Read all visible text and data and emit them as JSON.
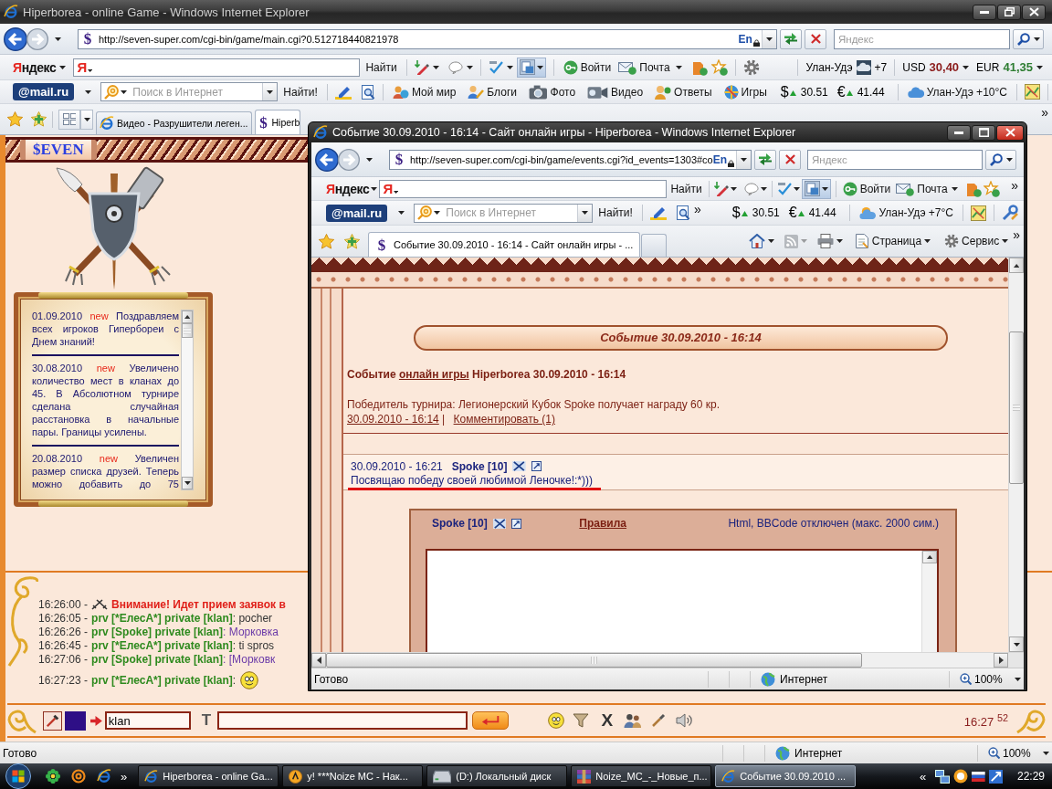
{
  "main_window": {
    "title": "Hiperborea - online Game - Windows Internet Explorer",
    "favicon": "$",
    "address": "http://seven-super.com/cgi-bin/game/main.cgi?0.512718440821978",
    "lang": "En",
    "search_placeholder": "Яндекс",
    "yandex_bar": {
      "logo": "Яндекс",
      "field_logo": "Я",
      "find": "Найти",
      "login": "Войти",
      "mail": "Почта",
      "city": "Улан-Удэ",
      "temperature": "+7",
      "currencies": [
        {
          "code": "USD",
          "value": "30,40",
          "color": "#8b1c1c"
        },
        {
          "code": "EUR",
          "value": "41,35",
          "color": "#2e7d32"
        }
      ]
    },
    "mail_bar": {
      "logo": "@mail.ru",
      "placeholder": "Поиск в Интернет",
      "find": "Найти!",
      "links": [
        {
          "kind": "world",
          "label": "Мой мир"
        },
        {
          "kind": "blogs",
          "label": "Блоги"
        },
        {
          "kind": "photo",
          "label": "Фото"
        },
        {
          "kind": "video",
          "label": "Видео"
        },
        {
          "kind": "answers",
          "label": "Ответы"
        },
        {
          "kind": "games",
          "label": "Игры"
        }
      ],
      "rates": [
        {
          "sign": "$",
          "value": "30.51"
        },
        {
          "sign": "€",
          "value": "41.44"
        }
      ],
      "weather": "Улан-Удэ +10°C"
    },
    "tabs": [
      {
        "kind": "ie",
        "label": "Видео - Разрушители леген...",
        "selected": false
      },
      {
        "kind": "site",
        "favicon": "$",
        "label": "Hiperb",
        "selected": true
      }
    ],
    "more": "»",
    "status": "Готово",
    "zone": "Интернет",
    "zoom": "100%"
  },
  "game": {
    "logo": "$EVEN",
    "news": [
      {
        "date": "01.09.2010",
        "badge": "new",
        "text": "Поздравляем всех игроков Гипербореи с Днем знаний!"
      },
      {
        "date": "30.08.2010",
        "badge": "new",
        "text": "Увеличено количество мест в кланах до 45. В Абсолютном турнире сделана случайная расстановка в начальные пары. Границы усилены."
      },
      {
        "date": "20.08.2010",
        "badge": "new",
        "text": "Увеличен размер списка друзей. Теперь можно добавить до 75"
      }
    ],
    "chat": [
      {
        "kind": "system",
        "time": "16:26:00 -",
        "text": "Внимание! Идет прием заявок в"
      },
      {
        "kind": "private",
        "time": "16:26:05 -",
        "sender": "prv [*ЕлесА*] private [klan]",
        "text": ": pocher",
        "color": "#333333"
      },
      {
        "kind": "private",
        "time": "16:26:26 -",
        "sender": "prv [Spoke] private [klan]",
        "text": ": Морковка",
        "color": "#6a3aa8"
      },
      {
        "kind": "private",
        "time": "16:26:45 -",
        "sender": "prv [*ЕлесА*] private [klan]",
        "text": ": ti spros",
        "color": "#333333"
      },
      {
        "kind": "private",
        "time": "16:27:06 -",
        "sender": "prv [Spoke] private [klan]",
        "text": ": [Морковк",
        "color": "#6a3aa8"
      },
      {
        "kind": "smiley",
        "time": "16:27:23 -",
        "sender": "prv [*ЕлесА*] private [klan]",
        "text": ":"
      }
    ],
    "input_bar": {
      "channel": "klan",
      "font_button": "T",
      "clear_button": "X",
      "clock": "16:27 $^{52}$"
    }
  },
  "event_window": {
    "title": "Событие 30.09.2010 - 16:14 - Сайт онлайн игры - Hiperborea - Windows Internet Explorer",
    "favicon": "$",
    "address": "http://seven-super.com/cgi-bin/game/events.cgi?id_events=1303#co",
    "lang": "En",
    "search_placeholder": "Яндекс",
    "yandex_bar": {
      "logo": "Яндекс",
      "field_logo": "Я",
      "find": "Найти",
      "login": "Войти",
      "mail": "Почта",
      "more": "»"
    },
    "mail_bar": {
      "logo": "@mail.ru",
      "placeholder": "Поиск в Интернет",
      "find": "Найти!",
      "more": "»",
      "rates": [
        {
          "sign": "$",
          "value": "30.51"
        },
        {
          "sign": "€",
          "value": "41.44"
        }
      ],
      "weather": "Улан-Удэ +7°C"
    },
    "tabs": [
      {
        "favicon": "$",
        "label": "Событие 30.09.2010 - 16:14 - Сайт онлайн игры - ...",
        "selected": true
      }
    ],
    "command_bar": {
      "page": "Страница",
      "tools": "Сервис",
      "more": "»"
    },
    "page": {
      "banner": "Событие 30.09.2010 - 16:14",
      "heading": {
        "before": "Событие",
        "link": "онлайн игры",
        "after": "Hiperborea 30.09.2010 - 16:14"
      },
      "summary": "Победитель турнира: Легионерский Кубок Spoke получает награду 60 кр.",
      "date_link": "30.09.2010 - 16:14",
      "separator": "|",
      "comment_link": "Комментировать (1)",
      "comments": [
        {
          "time": "30.09.2010 - 16:21",
          "author": "Spoke [10]",
          "text": "Посвящаю победу своей любимой Леночке!:*)))",
          "highlighted": true
        }
      ],
      "form": {
        "author": "Spoke [10]",
        "rules": "Правила",
        "note": "Html, BBCode отключен (макс. 2000 сим.)"
      }
    },
    "status": "Готово",
    "zone": "Интернет",
    "zoom": "100%"
  },
  "taskbar": {
    "quick_more": "»",
    "tasks": [
      {
        "kind": "ie",
        "label": "Hiperborea - online Ga...",
        "selected": false
      },
      {
        "kind": "yahoo",
        "label": "y! ***Noize MC - Нак...",
        "selected": false
      },
      {
        "kind": "drive",
        "label": "(D:) Локальный диск",
        "selected": false
      },
      {
        "kind": "archive",
        "label": "Noize_MC_-_Новые_п...",
        "selected": false
      },
      {
        "kind": "ie",
        "label": "Событие 30.09.2010 ...",
        "selected": true
      }
    ],
    "tray_more": "«",
    "clock": "22:29"
  }
}
